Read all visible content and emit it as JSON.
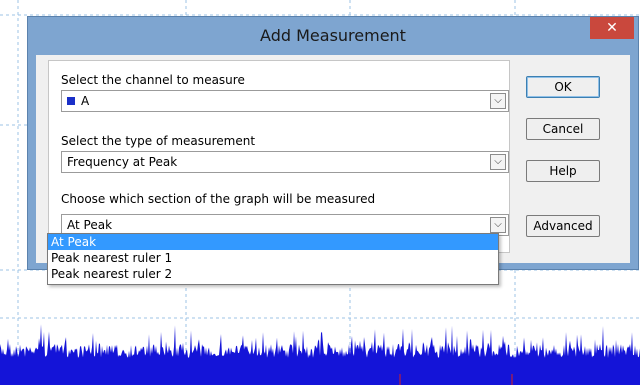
{
  "dialog": {
    "title": "Add Measurement",
    "close_icon": "close-icon",
    "channel": {
      "label": "Select the channel to measure",
      "value": "A",
      "swatch_color": "#1a2fc8"
    },
    "type": {
      "label": "Select the type of measurement",
      "value": "Frequency at Peak"
    },
    "section": {
      "label": "Choose which section of the graph will be measured",
      "value": "At Peak",
      "options": [
        "At Peak",
        "Peak nearest ruler 1",
        "Peak nearest ruler 2"
      ],
      "selected_index": 0
    },
    "buttons": {
      "ok": "OK",
      "cancel": "Cancel",
      "help": "Help",
      "advanced": "Advanced"
    }
  },
  "colors": {
    "signal_trace": "#1414d8",
    "ruler_marker": "#d82020",
    "dialog_frame": "#7ea5d0",
    "close_button": "#c9483d",
    "selection": "#3399ff"
  }
}
